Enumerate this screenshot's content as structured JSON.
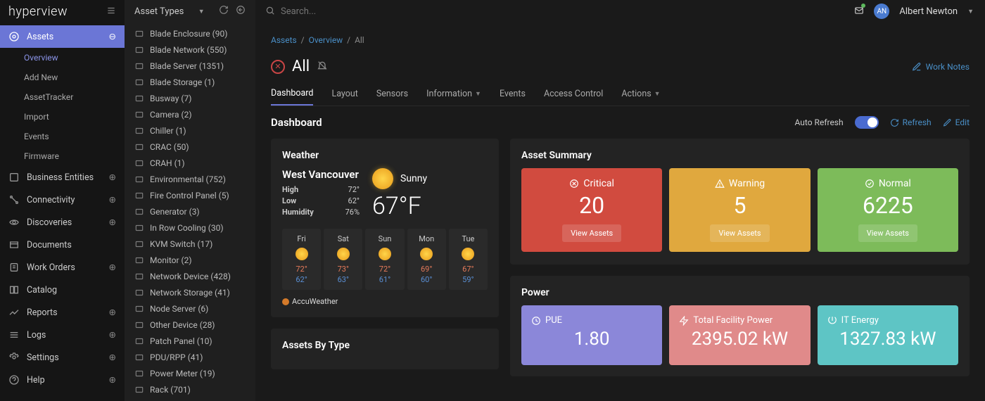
{
  "brand": "hyperview",
  "asset_types_label": "Asset Types",
  "search": {
    "placeholder": "Search..."
  },
  "user": {
    "initials": "AN",
    "name": "Albert Newton"
  },
  "sidebar": {
    "items": [
      {
        "label": "Assets"
      },
      {
        "label": "Business Entities"
      },
      {
        "label": "Connectivity"
      },
      {
        "label": "Discoveries"
      },
      {
        "label": "Documents"
      },
      {
        "label": "Work Orders"
      },
      {
        "label": "Catalog"
      },
      {
        "label": "Reports"
      },
      {
        "label": "Logs"
      },
      {
        "label": "Settings"
      },
      {
        "label": "Help"
      }
    ],
    "assets_sub": [
      {
        "label": "Overview"
      },
      {
        "label": "Add New"
      },
      {
        "label": "AssetTracker"
      },
      {
        "label": "Import"
      },
      {
        "label": "Events"
      },
      {
        "label": "Firmware"
      }
    ]
  },
  "types": [
    {
      "label": "Blade Enclosure (90)"
    },
    {
      "label": "Blade Network (550)"
    },
    {
      "label": "Blade Server (1351)"
    },
    {
      "label": "Blade Storage (1)"
    },
    {
      "label": "Busway (7)"
    },
    {
      "label": "Camera (2)"
    },
    {
      "label": "Chiller (1)"
    },
    {
      "label": "CRAC (50)"
    },
    {
      "label": "CRAH (1)"
    },
    {
      "label": "Environmental (752)"
    },
    {
      "label": "Fire Control Panel (5)"
    },
    {
      "label": "Generator (3)"
    },
    {
      "label": "In Row Cooling (30)"
    },
    {
      "label": "KVM Switch (17)"
    },
    {
      "label": "Monitor (2)"
    },
    {
      "label": "Network Device (428)"
    },
    {
      "label": "Network Storage (41)"
    },
    {
      "label": "Node Server (6)"
    },
    {
      "label": "Other Device (28)"
    },
    {
      "label": "Patch Panel (10)"
    },
    {
      "label": "PDU/RPP (41)"
    },
    {
      "label": "Power Meter (19)"
    },
    {
      "label": "Rack (701)"
    }
  ],
  "breadcrumb": {
    "a": "Assets",
    "b": "Overview",
    "c": "All"
  },
  "page": {
    "title": "All",
    "worknotes": "Work Notes"
  },
  "tabs": [
    "Dashboard",
    "Layout",
    "Sensors",
    "Information",
    "Events",
    "Access Control",
    "Actions"
  ],
  "dash": {
    "title": "Dashboard",
    "auto_refresh": "Auto Refresh",
    "refresh": "Refresh",
    "edit": "Edit"
  },
  "weather": {
    "title": "Weather",
    "city": "West Vancouver",
    "condition": "Sunny",
    "temp": "67°F",
    "high_l": "High",
    "high_v": "72°",
    "low_l": "Low",
    "low_v": "62°",
    "hum_l": "Humidity",
    "hum_v": "76%",
    "forecast": [
      {
        "d": "Fri",
        "hi": "72°",
        "lo": "62°"
      },
      {
        "d": "Sat",
        "hi": "73°",
        "lo": "63°"
      },
      {
        "d": "Sun",
        "hi": "72°",
        "lo": "61°"
      },
      {
        "d": "Mon",
        "hi": "69°",
        "lo": "60°"
      },
      {
        "d": "Tue",
        "hi": "67°",
        "lo": "59°"
      }
    ],
    "provider": "AccuWeather"
  },
  "assets_by_type_title": "Assets By Type",
  "summary": {
    "title": "Asset Summary",
    "view_label": "View Assets",
    "critical": {
      "label": "Critical",
      "value": "20"
    },
    "warning": {
      "label": "Warning",
      "value": "5"
    },
    "normal": {
      "label": "Normal",
      "value": "6225"
    }
  },
  "power": {
    "title": "Power",
    "pue": {
      "label": "PUE",
      "value": "1.80"
    },
    "tfp": {
      "label": "Total Facility Power",
      "value": "2395.02 kW"
    },
    "ite": {
      "label": "IT Energy",
      "value": "1327.83 kW"
    }
  }
}
